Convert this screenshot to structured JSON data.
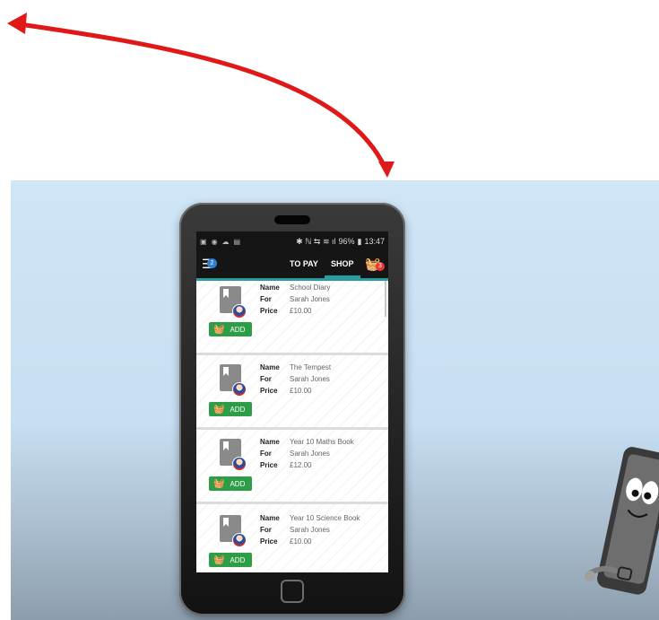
{
  "status_bar": {
    "left_icons": [
      "notification-icon",
      "android-icon",
      "cloud-icon",
      "briefcase-icon"
    ],
    "right_text": "✳ N ⇷ ᴜ ▌ 96% ■ 13:47",
    "battery": "96%",
    "time": "13:47"
  },
  "app_bar": {
    "filter_badge": "2",
    "tabs": [
      {
        "label": "TO PAY"
      },
      {
        "label": "SHOP"
      }
    ],
    "basket_badge": "3"
  },
  "items": [
    {
      "name_label": "Name",
      "name": "School Diary",
      "for_label": "For",
      "for": "Sarah Jones",
      "price_label": "Price",
      "price": "£10.00",
      "add_label": "ADD"
    },
    {
      "name_label": "Name",
      "name": "The Tempest",
      "for_label": "For",
      "for": "Sarah Jones",
      "price_label": "Price",
      "price": "£10.00",
      "add_label": "ADD"
    },
    {
      "name_label": "Name",
      "name": "Year 10 Maths Book",
      "for_label": "For",
      "for": "Sarah Jones",
      "price_label": "Price",
      "price": "£12.00",
      "add_label": "ADD"
    },
    {
      "name_label": "Name",
      "name": "Year 10 Science Book",
      "for_label": "For",
      "for": "Sarah Jones",
      "price_label": "Price",
      "price": "£10.00",
      "add_label": "ADD"
    }
  ],
  "colors": {
    "accent": "#2a9aa3",
    "add_button": "#2e9d48",
    "arrow": "#e01818",
    "badge_red": "#e53935",
    "badge_blue": "#2f7fd6"
  }
}
